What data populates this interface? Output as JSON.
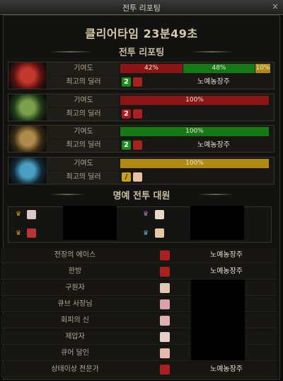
{
  "window": {
    "title": "전투 리포팅",
    "close": "×"
  },
  "clear_time": "클리어타임 23분49초",
  "section_report": "전투 리포팅",
  "section_honor": "명예 전투 대원",
  "labels": {
    "contribution": "기여도",
    "best_dealer": "최고의 딜러"
  },
  "parties": [
    {
      "emblem": "fire",
      "bars": [
        {
          "v": 42,
          "text": "42%",
          "color": "#8b1414"
        },
        {
          "v": 48,
          "text": "48%",
          "color": "#157a15"
        },
        {
          "v": 10,
          "text": "10%",
          "color": "#b08a10"
        }
      ],
      "rank": "2",
      "rank_color": "#1a8c1a",
      "dealer": "노예농장주"
    },
    {
      "emblem": "nature",
      "bars": [
        {
          "v": 100,
          "text": "100%",
          "color": "#8b1414"
        }
      ],
      "rank": "2",
      "rank_color": "#b01818",
      "dealer": ""
    },
    {
      "emblem": "earth",
      "bars": [
        {
          "v": 100,
          "text": "100%",
          "color": "#157a15"
        }
      ],
      "rank": "2",
      "rank_color": "#1a8c1a",
      "dealer": "노예농장주"
    },
    {
      "emblem": "water",
      "bars": [
        {
          "v": 100,
          "text": "100%",
          "color": "#b08a10"
        }
      ],
      "rank": "/",
      "rank_color": "#c9a20f",
      "dealer": ""
    }
  ],
  "titles": [
    {
      "name": "전장의 에이스",
      "player": "노예농장주"
    },
    {
      "name": "한방",
      "player": "노예농장주"
    },
    {
      "name": "구원자",
      "player": ""
    },
    {
      "name": "큐브 사장님",
      "player": ""
    },
    {
      "name": "회피의 신",
      "player": ""
    },
    {
      "name": "제압자",
      "player": ""
    },
    {
      "name": "큐어 달인",
      "player": ""
    },
    {
      "name": "상태이상 전문가",
      "player": "노예농장주"
    }
  ]
}
